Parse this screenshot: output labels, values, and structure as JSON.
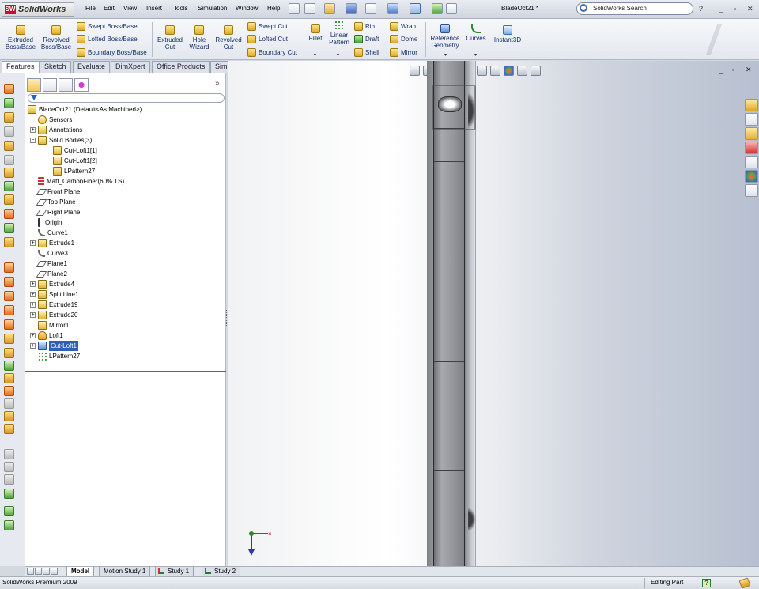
{
  "app": {
    "name": "SolidWorks",
    "logo_mark": "SW",
    "document_title": "BladeOct21 *",
    "search_placeholder": "SolidWorks Search",
    "help_symbol": "?"
  },
  "menu": [
    "File",
    "Edit",
    "View",
    "Insert",
    "Tools",
    "Simulation",
    "Window",
    "Help"
  ],
  "command_manager": {
    "extruded_boss": "Extruded Boss/Base",
    "revolved_boss": "Revolved Boss/Base",
    "swept_boss": "Swept Boss/Base",
    "lofted_boss": "Lofted Boss/Base",
    "boundary_boss": "Boundary Boss/Base",
    "extruded_cut": "Extruded Cut",
    "hole_wizard": "Hole Wizard",
    "revolved_cut": "Revolved Cut",
    "swept_cut": "Swept Cut",
    "lofted_cut": "Lofted Cut",
    "boundary_cut": "Boundary Cut",
    "fillet": "Fillet",
    "linear_pattern": "Linear Pattern",
    "rib": "Rib",
    "draft": "Draft",
    "shell": "Shell",
    "wrap": "Wrap",
    "dome": "Dome",
    "mirror": "Mirror",
    "reference_geometry": "Reference Geometry",
    "curves": "Curves",
    "instant3d": "Instant3D"
  },
  "tabs": [
    "Features",
    "Sketch",
    "Evaluate",
    "DimXpert",
    "Office Products",
    "Simulation"
  ],
  "active_tab": "Features",
  "feature_tree": {
    "root": "BladeOct21  (Default<As Machined>)",
    "items": [
      {
        "label": "Sensors",
        "icon": "sensors-icon",
        "expander": false,
        "indent": 1
      },
      {
        "label": "Annotations",
        "icon": "annotations-icon",
        "expander": true,
        "indent": 1
      },
      {
        "label": "Solid Bodies(3)",
        "icon": "solid-bodies-icon",
        "expander": true,
        "indent": 1,
        "expanded": true
      },
      {
        "label": "Cut-Loft1[1]",
        "icon": "solid-body-icon",
        "expander": false,
        "indent": 2
      },
      {
        "label": "Cut-Loft1[2]",
        "icon": "solid-body-icon",
        "expander": false,
        "indent": 2
      },
      {
        "label": "LPattern27",
        "icon": "solid-body-icon",
        "expander": false,
        "indent": 2
      },
      {
        "label": "Matt_CarbonFiber(60% TS)",
        "icon": "material-icon",
        "expander": false,
        "indent": 1
      },
      {
        "label": "Front Plane",
        "icon": "plane-icon",
        "expander": false,
        "indent": 1
      },
      {
        "label": "Top Plane",
        "icon": "plane-icon",
        "expander": false,
        "indent": 1
      },
      {
        "label": "Right Plane",
        "icon": "plane-icon",
        "expander": false,
        "indent": 1
      },
      {
        "label": "Origin",
        "icon": "origin-icon",
        "expander": false,
        "indent": 1
      },
      {
        "label": "Curve1",
        "icon": "curve-icon",
        "expander": false,
        "indent": 1
      },
      {
        "label": "Extrude1",
        "icon": "extrude-icon",
        "expander": true,
        "indent": 1
      },
      {
        "label": "Curve3",
        "icon": "curve-icon",
        "expander": false,
        "indent": 1
      },
      {
        "label": "Plane1",
        "icon": "plane-icon",
        "expander": false,
        "indent": 1
      },
      {
        "label": "Plane2",
        "icon": "plane-icon",
        "expander": false,
        "indent": 1
      },
      {
        "label": "Extrude4",
        "icon": "extrude-icon",
        "expander": true,
        "indent": 1
      },
      {
        "label": "Split Line1",
        "icon": "split-line-icon",
        "expander": true,
        "indent": 1
      },
      {
        "label": "Extrude19",
        "icon": "extrude-icon",
        "expander": true,
        "indent": 1
      },
      {
        "label": "Extrude20",
        "icon": "extrude-icon",
        "expander": true,
        "indent": 1
      },
      {
        "label": "Mirror1",
        "icon": "mirror-icon",
        "expander": false,
        "indent": 1
      },
      {
        "label": "Loft1",
        "icon": "loft-icon",
        "expander": true,
        "indent": 1
      },
      {
        "label": "Cut-Loft1",
        "icon": "cut-loft-icon",
        "expander": true,
        "indent": 1,
        "selected": true
      },
      {
        "label": "LPattern27",
        "icon": "linear-pattern-icon",
        "expander": false,
        "indent": 1
      }
    ]
  },
  "bottom_tabs": [
    "Model",
    "Motion Study 1",
    "Study 1",
    "Study 2"
  ],
  "active_bottom_tab": "Model",
  "status": {
    "product": "SolidWorks Premium 2009",
    "mode": "Editing Part",
    "help_symbol": "?"
  },
  "window_controls": {
    "minimize": "_",
    "restore": "▫",
    "close": "✕"
  },
  "colors": {
    "selection": "#2f5fb3",
    "rollback_bar": "#3a69b8",
    "brand": "#c8102e"
  }
}
